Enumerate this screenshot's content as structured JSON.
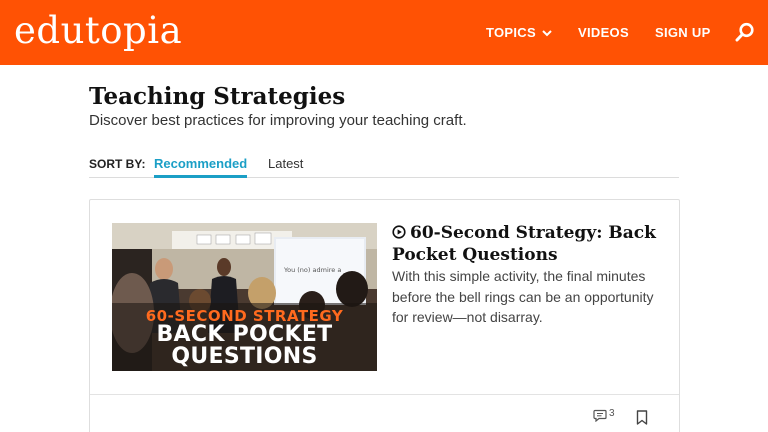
{
  "header": {
    "logo_text": "edutopia",
    "brand_color": "#ff5204",
    "nav": {
      "topics_label": "TOPICS",
      "videos_label": "VIDEOS",
      "signup_label": "SIGN UP"
    },
    "search_icon": "search-icon"
  },
  "page": {
    "title": "Teaching Strategies",
    "subtitle": "Discover best practices for improving your teaching craft."
  },
  "sort": {
    "label": "SORT BY:",
    "options": [
      "Recommended",
      "Latest"
    ],
    "selected": "Recommended",
    "accent_color": "#1b9fc6"
  },
  "article": {
    "thumbnail": {
      "line1": "60-SECOND STRATEGY",
      "line2": "BACK POCKET",
      "line3": "QUESTIONS",
      "board_text": "You (no) admire a ___."
    },
    "title": "60-Second Strategy: Back Pocket Questions",
    "description": "With this simple activity, the final minutes before the bell rings can be an opportunity for review—not disarray.",
    "comment_count": "3",
    "video_icon": "play-circle-icon"
  }
}
